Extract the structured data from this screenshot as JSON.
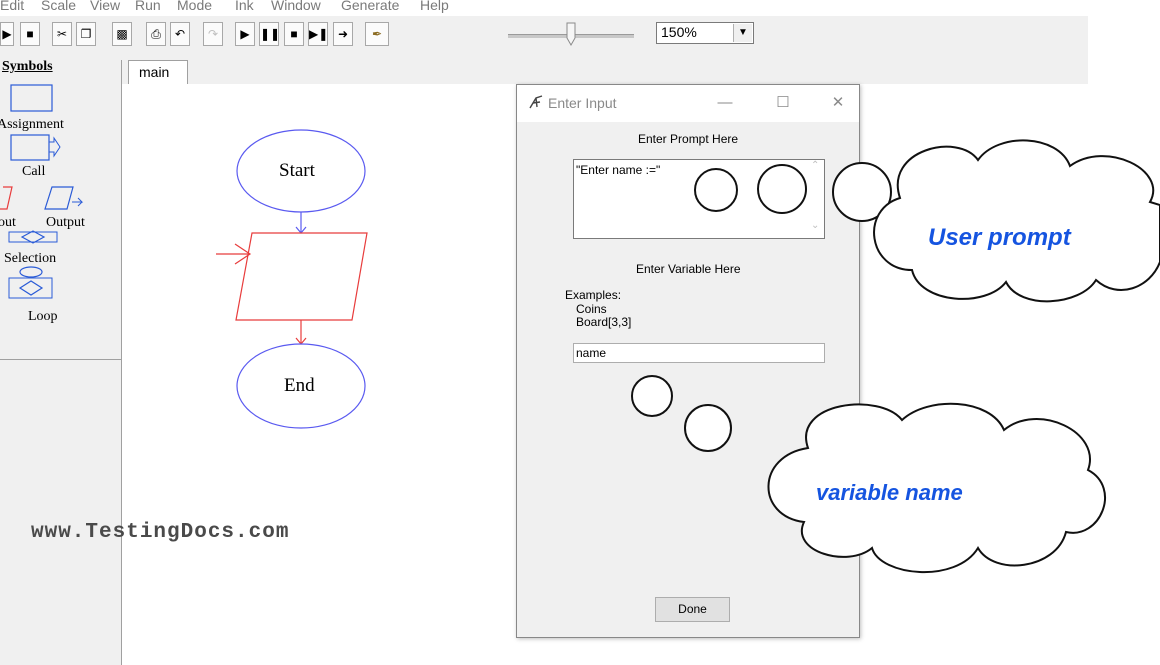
{
  "menu": [
    "Edit",
    "Scale",
    "View",
    "Run",
    "Mode",
    "Ink",
    "Window",
    "Generate",
    "Help"
  ],
  "toolbar": {
    "zoom_value": "150%",
    "zoom_slider_fraction": 0.5
  },
  "symbols": {
    "heading": "Symbols",
    "items": {
      "assignment": "Assignment",
      "call": "Call",
      "input": "out",
      "output": "Output",
      "selection": "Selection",
      "loop": "Loop"
    }
  },
  "tabs": [
    "main"
  ],
  "flowchart": {
    "start": "Start",
    "end": "End"
  },
  "dialog": {
    "title": "Enter Input",
    "prompt_heading": "Enter Prompt Here",
    "prompt_value": "\"Enter name :=\"",
    "variable_heading": "Enter Variable Here",
    "examples_label": "Examples:",
    "example_1": "Coins",
    "example_2": "Board[3,3]",
    "variable_value": "name",
    "done_label": "Done"
  },
  "annotations": {
    "watermark": "www.TestingDocs.com",
    "user_prompt_callout": "User prompt",
    "variable_name_callout": "variable name"
  },
  "colors": {
    "flow_oval": "#5a5af0",
    "flow_input": "#e83c3c",
    "callout_text": "#1554e0"
  }
}
